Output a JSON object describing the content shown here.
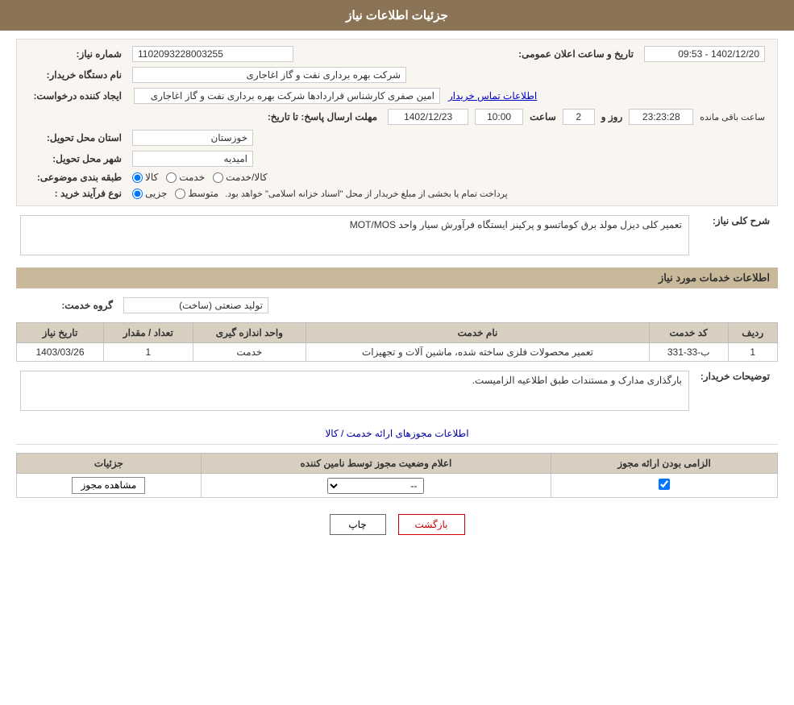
{
  "header": {
    "title": "جزئیات اطلاعات نیاز"
  },
  "fields": {
    "need_number_label": "شماره نیاز:",
    "need_number_value": "1102093228003255",
    "buyer_label": "نام دستگاه خریدار:",
    "buyer_value": "شرکت بهره برداری نفت و گاز اغاجاری",
    "creator_label": "ایجاد کننده درخواست:",
    "creator_value": "امین صفری کارشناس قراردادها شرکت بهره برداری نفت و گاز اغاجاری",
    "contact_link": "اطلاعات تماس خریدار",
    "deadline_label": "مهلت ارسال پاسخ: تا تاریخ:",
    "date_value": "1402/12/23",
    "time_label": "ساعت",
    "time_value": "10:00",
    "days_label": "روز و",
    "days_value": "2",
    "time_remaining_label": "ساعت باقی مانده",
    "time_remaining_value": "23:23:28",
    "announce_label": "تاریخ و ساعت اعلان عمومی:",
    "announce_value": "1402/12/20 - 09:53",
    "province_label": "استان محل تحویل:",
    "province_value": "خوزستان",
    "city_label": "شهر محل تحویل:",
    "city_value": "امیدیه",
    "category_label": "طبقه بندی موضوعی:",
    "category_option1": "کالا",
    "category_option2": "خدمت",
    "category_option3": "کالا/خدمت",
    "category_selected": "کالا",
    "purchase_label": "نوع فرآیند خرید :",
    "purchase_option1": "جزیی",
    "purchase_option2": "متوسط",
    "purchase_note": "پرداخت تمام یا بخشی از مبلغ خریدار از محل \"اسناد خزانه اسلامی\" خواهد بود.",
    "description_label": "شرح کلی نیاز:",
    "description_value": "تعمیر کلی دیزل مولد برق کوماتسو و پرکینز ایستگاه فرآورش سیار واحد MOT/MOS",
    "services_section": "اطلاعات خدمات مورد نیاز",
    "service_group_label": "گروه خدمت:",
    "service_group_value": "تولید صنعتی (ساخت)",
    "table": {
      "headers": [
        "ردیف",
        "کد خدمت",
        "نام خدمت",
        "واحد اندازه گیری",
        "تعداد / مقدار",
        "تاریخ نیاز"
      ],
      "rows": [
        {
          "row": "1",
          "code": "ب-33-331",
          "name": "تعمیر محصولات فلزی ساخته شده، ماشین آلات و تجهیزات",
          "unit": "خدمت",
          "qty": "1",
          "date": "1403/03/26"
        }
      ]
    },
    "buyer_desc_label": "توضیحات خریدار:",
    "buyer_desc_value": "بارگذاری مدارک و مستندات طبق اطلاعیه الزامیست.",
    "permit_section_title": "اطلاعات مجوزهای ارائه خدمت / کالا",
    "permit_table": {
      "headers": [
        "الزامی بودن ارائه مجوز",
        "اعلام وضعیت مجوز توسط نامین کننده",
        "جزئیات"
      ],
      "rows": [
        {
          "required": true,
          "status": "--",
          "btn": "مشاهده مجوز"
        }
      ]
    }
  },
  "buttons": {
    "print_label": "چاپ",
    "back_label": "بازگشت"
  }
}
